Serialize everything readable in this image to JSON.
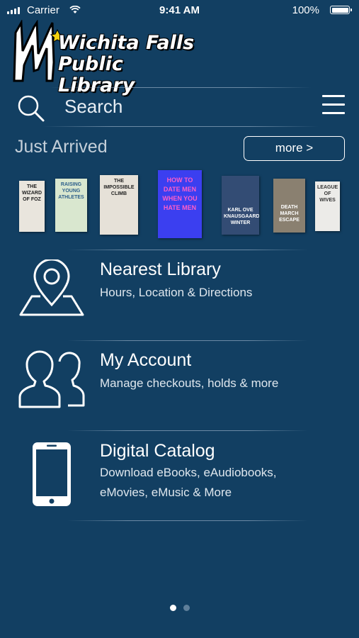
{
  "status_bar": {
    "carrier": "Carrier",
    "time": "9:41 AM",
    "battery": "100%"
  },
  "logo": {
    "line1": "Wichita Falls",
    "line2": "Public Library"
  },
  "search": {
    "label": "Search"
  },
  "just_arrived": {
    "heading": "Just Arrived",
    "more_label": "more >",
    "books": [
      {
        "title": "THE WIZARD OF FOZ",
        "color": "#e9e5dd",
        "text_color": "#1c1c1c"
      },
      {
        "title": "RAISING YOUNG ATHLETES",
        "color": "#d9e7cf",
        "text_color": "#2d5f8a"
      },
      {
        "title": "THE IMPOSSIBLE CLIMB",
        "color": "#e6e1d8",
        "text_color": "#222222"
      },
      {
        "title": "HOW TO DATE MEN WHEN YOU HATE MEN",
        "color": "#3b3ff0",
        "text_color": "#ff5ec8"
      },
      {
        "title": "KARL OVE KNAUSGAARD WINTER",
        "color": "#334c74",
        "text_color": "#ffffff"
      },
      {
        "title": "DEATH MARCH ESCAPE",
        "color": "#8a8070",
        "text_color": "#ffffff"
      },
      {
        "title": "LEAGUE OF WIVES",
        "color": "#ecebe8",
        "text_color": "#333333"
      }
    ]
  },
  "menu": [
    {
      "title": "Nearest Library",
      "sub1": "Hours, Location & Directions",
      "sub2": "",
      "icon": "map-pin-icon"
    },
    {
      "title": "My Account",
      "sub1": "Manage checkouts, holds & more",
      "sub2": "",
      "icon": "users-icon"
    },
    {
      "title": "Digital Catalog",
      "sub1": "Download eBooks, eAudiobooks,",
      "sub2": "eMovies, eMusic & More",
      "icon": "phone-icon"
    }
  ],
  "pager": {
    "total": 2,
    "active": 1
  }
}
